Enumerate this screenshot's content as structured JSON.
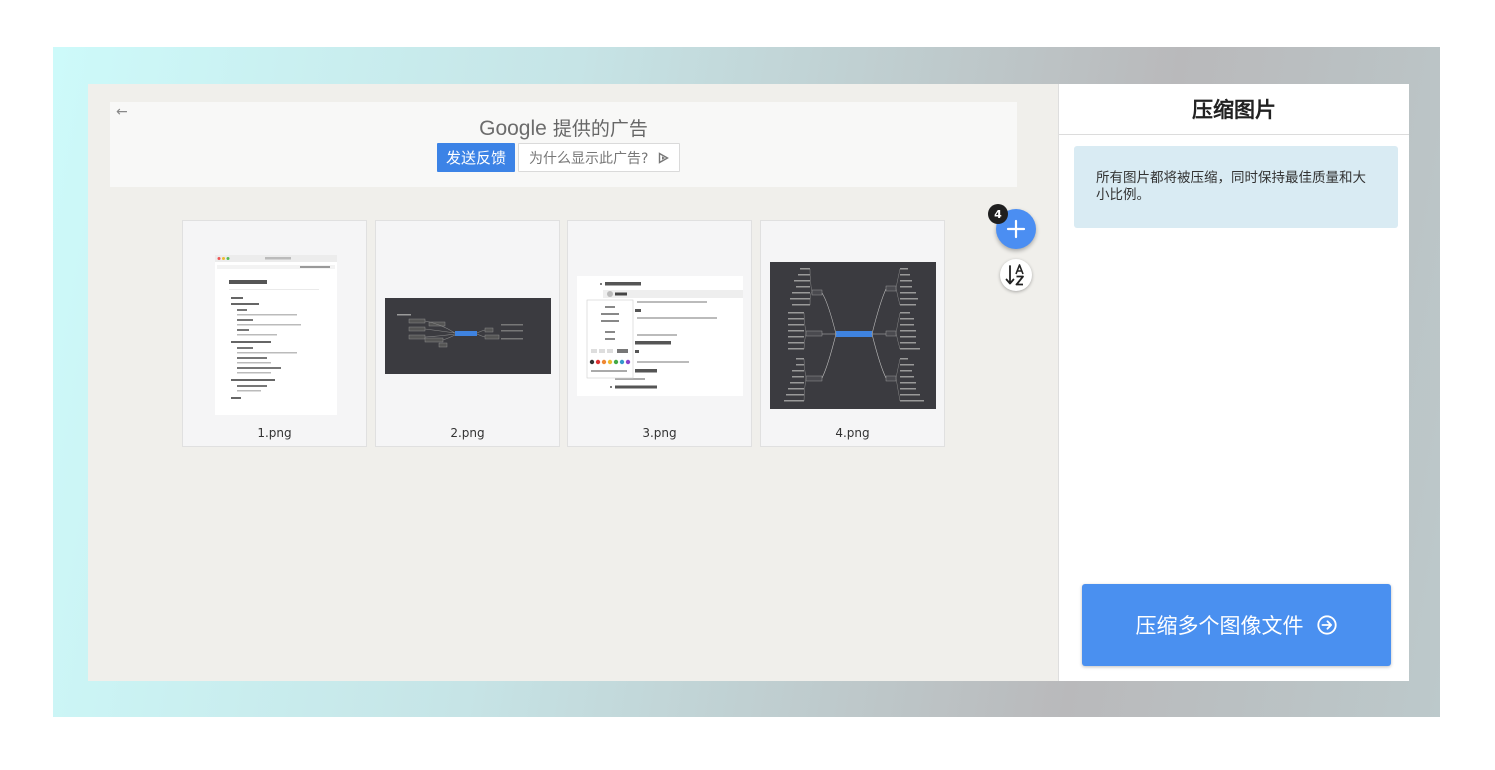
{
  "ad": {
    "back_icon": "arrow-left-icon",
    "brand": "Google",
    "title_suffix": "提供的广告",
    "feedback_label": "发送反馈",
    "why_label": "为什么显示此广告?",
    "why_icon": "adchoices-icon"
  },
  "files": [
    {
      "name": "1.png"
    },
    {
      "name": "2.png"
    },
    {
      "name": "3.png"
    },
    {
      "name": "4.png"
    }
  ],
  "toolbar": {
    "add_count": "4",
    "add_icon": "plus-icon",
    "sort_icon": "sort-alpha-icon"
  },
  "sidebar": {
    "title": "压缩图片",
    "info": "所有图片都将被压缩，同时保持最佳质量和大小比例。",
    "action_label": "压缩多个图像文件",
    "action_icon": "arrow-right-circle-icon"
  },
  "colors": {
    "accent": "#4a90f0",
    "info_bg": "#d9ebf3",
    "workspace_bg": "#f0efeb"
  }
}
